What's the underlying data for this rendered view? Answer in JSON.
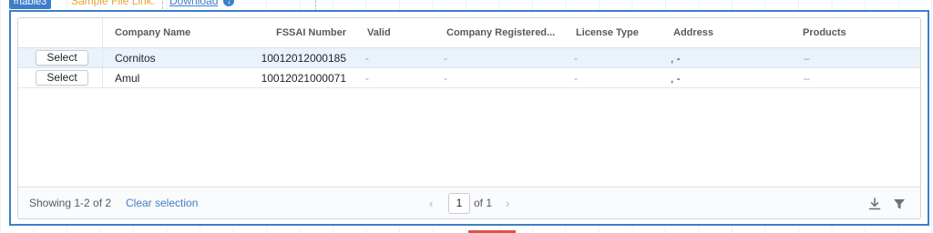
{
  "topbar": {
    "component_tag": "table3",
    "sample_label": "Sample File Link:",
    "download_label": "Download"
  },
  "table": {
    "columns": {
      "company_name": "Company Name",
      "fssai_number": "FSSAI Number",
      "valid": "Valid",
      "company_registered": "Company Registered...",
      "license_type": "License Type",
      "address": "Address",
      "products": "Products"
    },
    "rows": [
      {
        "select_label": "Select",
        "company_name": "Cornitos",
        "fssai_number": "10012012000185",
        "valid": "-",
        "company_registered": "-",
        "license_type": "-",
        "address": ", -",
        "products": "–",
        "selected": true
      },
      {
        "select_label": "Select",
        "company_name": "Amul",
        "fssai_number": "10012021000071",
        "valid": "-",
        "company_registered": "-",
        "license_type": "-",
        "address": ", -",
        "products": "–",
        "selected": false
      }
    ]
  },
  "footer": {
    "showing_text": "Showing 1-2 of 2",
    "clear_selection_label": "Clear selection",
    "current_page": "1",
    "of_pages": "of 1"
  },
  "colors": {
    "accent": "#3d7ec9",
    "sample_label": "#e6a33d",
    "selected_row": "#eaf2fb"
  }
}
